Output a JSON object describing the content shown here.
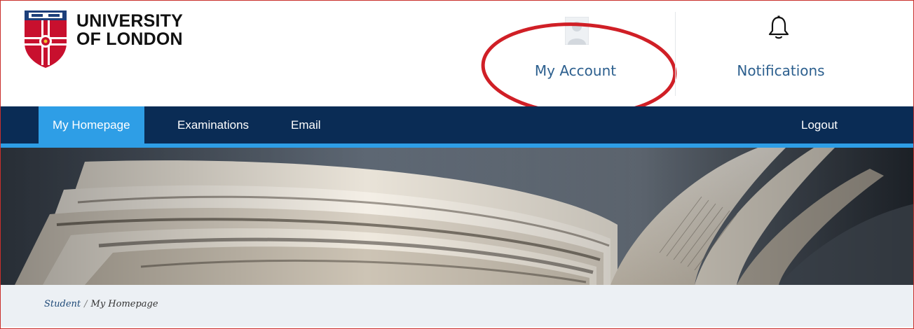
{
  "header": {
    "logo_line1": "UNIVERSITY",
    "logo_line2": "OF LONDON",
    "account_label": "My Account",
    "notifications_label": "Notifications"
  },
  "nav": {
    "items": [
      {
        "label": "My Homepage",
        "active": true
      },
      {
        "label": "Examinations",
        "active": false
      },
      {
        "label": "Email",
        "active": false
      }
    ],
    "logout_label": "Logout"
  },
  "breadcrumb": {
    "root": "Student",
    "separator": "/",
    "current": "My Homepage"
  },
  "colors": {
    "nav_bg": "#0a2c55",
    "accent_blue": "#2e9ee6",
    "link_blue": "#2c5f8e",
    "highlight_red": "#d01f26",
    "breadcrumb_bg": "#ecf0f4"
  },
  "icons": {
    "crest": "university-crest-icon",
    "avatar": "user-avatar-icon",
    "bell": "bell-icon"
  }
}
